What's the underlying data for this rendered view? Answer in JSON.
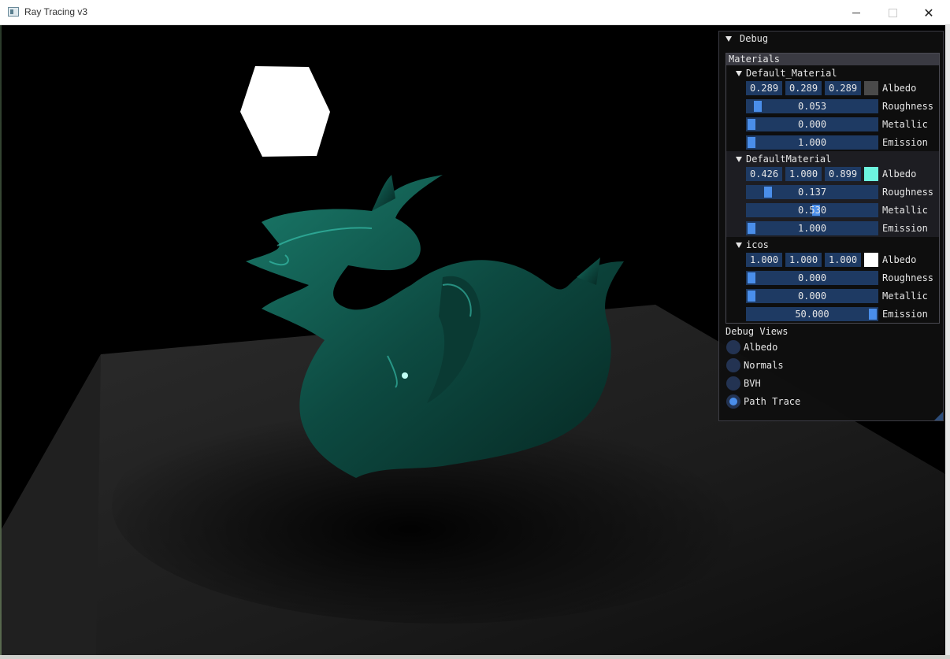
{
  "window": {
    "title": "Ray Tracing v3"
  },
  "debug": {
    "title": "Debug",
    "materials_header": "Materials",
    "materials": [
      {
        "name": "Default_Material",
        "albedo": [
          "0.289",
          "0.289",
          "0.289"
        ],
        "albedo_color": "#4a4a4a",
        "roughness": "0.053",
        "roughness_fraction": 0.053,
        "metallic": "0.000",
        "metallic_fraction": 0.0,
        "emission": "1.000",
        "emission_fraction": 0.0
      },
      {
        "name": "DefaultMaterial",
        "albedo": [
          "0.426",
          "1.000",
          "0.899"
        ],
        "albedo_color": "#6df5df",
        "roughness": "0.137",
        "roughness_fraction": 0.137,
        "metallic": "0.530",
        "metallic_fraction": 0.53,
        "emission": "1.000",
        "emission_fraction": 0.0
      },
      {
        "name": "icos",
        "albedo": [
          "1.000",
          "1.000",
          "1.000"
        ],
        "albedo_color": "#ffffff",
        "roughness": "0.000",
        "roughness_fraction": 0.0,
        "metallic": "0.000",
        "metallic_fraction": 0.0,
        "emission": "50.000",
        "emission_fraction": 1.0
      }
    ],
    "labels": {
      "albedo": "Albedo",
      "roughness": "Roughness",
      "metallic": "Metallic",
      "emission": "Emission"
    },
    "debug_views_label": "Debug Views",
    "views": [
      {
        "label": "Albedo",
        "selected": false
      },
      {
        "label": "Normals",
        "selected": false
      },
      {
        "label": "BVH",
        "selected": false
      },
      {
        "label": "Path Trace",
        "selected": true
      }
    ],
    "colors": {
      "slider_bg": "#1e3a63",
      "grab": "#4a8eea",
      "dragon": "#0f5a4e",
      "light": "#ffffff"
    }
  }
}
